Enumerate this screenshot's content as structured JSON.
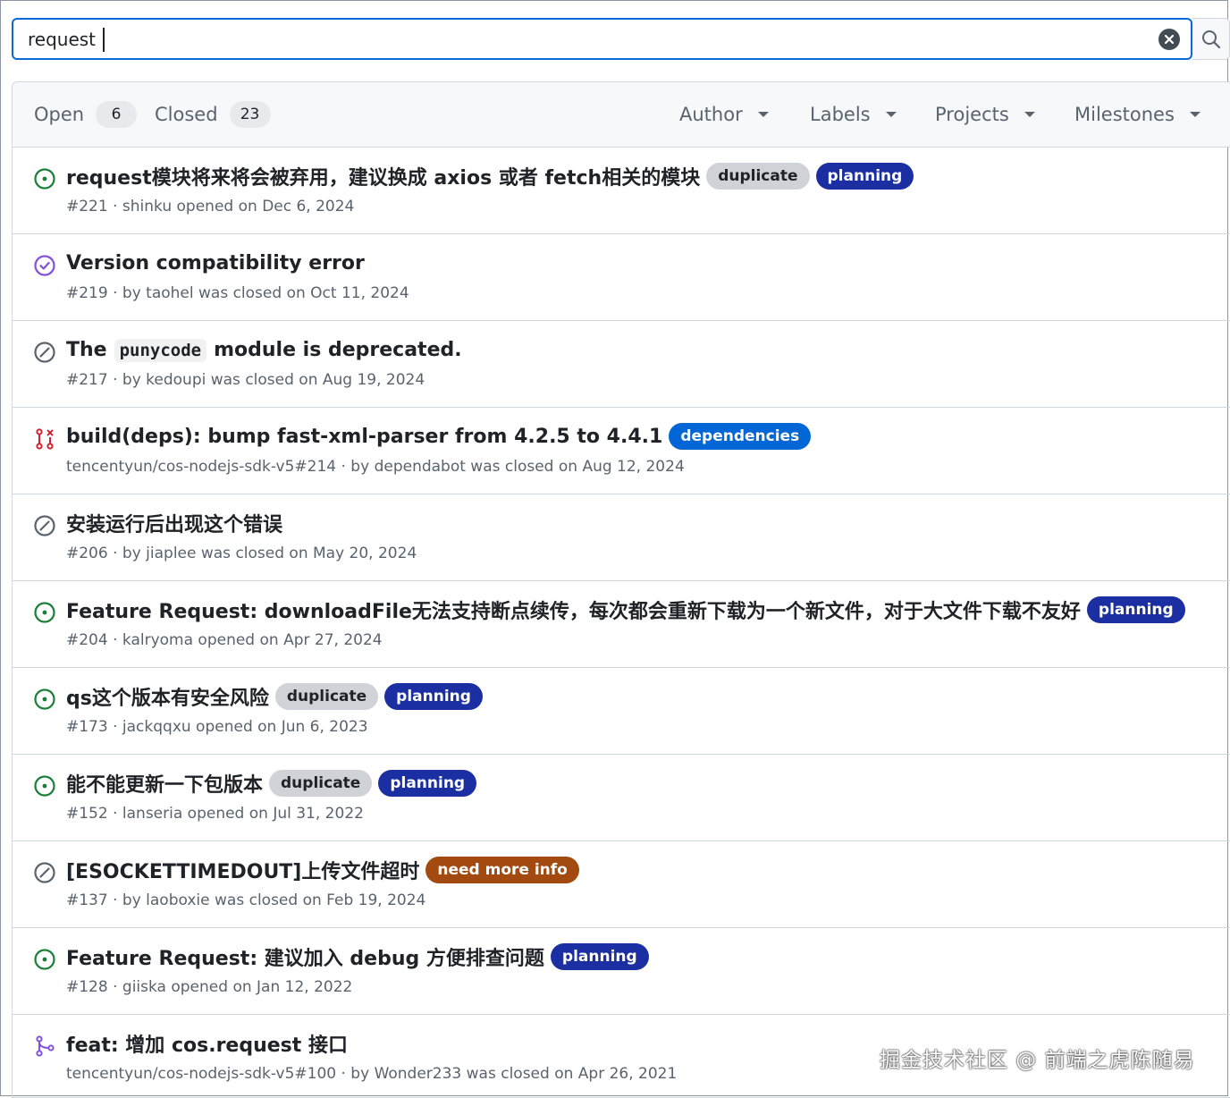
{
  "search": {
    "value": "request"
  },
  "tabs": {
    "open": {
      "label": "Open",
      "count": "6"
    },
    "closed": {
      "label": "Closed",
      "count": "23"
    }
  },
  "filters": [
    {
      "label": "Author"
    },
    {
      "label": "Labels"
    },
    {
      "label": "Projects"
    },
    {
      "label": "Milestones"
    }
  ],
  "issues": [
    {
      "state": "open",
      "title": "request模块将来将会被弃用，建议换成 axios 或者 fetch相关的模块",
      "labels": [
        "duplicate",
        "planning"
      ],
      "meta": "#221 · shinku opened on Dec 6, 2024"
    },
    {
      "state": "completed",
      "title": "Version compatibility error",
      "labels": [],
      "meta": "#219 · by taohel was closed on Oct 11, 2024"
    },
    {
      "state": "not-planned",
      "title_parts": [
        "The",
        "punycode",
        "module is deprecated."
      ],
      "labels": [],
      "meta": "#217 · by kedoupi was closed on Aug 19, 2024"
    },
    {
      "state": "pr-closed",
      "title": "build(deps): bump fast-xml-parser from 4.2.5 to 4.4.1",
      "labels": [
        "dependencies"
      ],
      "meta": "tencentyun/cos-nodejs-sdk-v5#214 · by dependabot was closed on Aug 12, 2024"
    },
    {
      "state": "not-planned",
      "title": "安装运行后出现这个错误",
      "labels": [],
      "meta": "#206 · by jiaplee was closed on May 20, 2024"
    },
    {
      "state": "open",
      "title": "Feature Request: downloadFile无法支持断点续传，每次都会重新下载为一个新文件，对于大文件下载不友好",
      "labels": [
        "planning"
      ],
      "meta": "#204 · kalryoma opened on Apr 27, 2024"
    },
    {
      "state": "open",
      "title": "qs这个版本有安全风险",
      "labels": [
        "duplicate",
        "planning"
      ],
      "meta": "#173 · jackqqxu opened on Jun 6, 2023"
    },
    {
      "state": "open",
      "title": "能不能更新一下包版本",
      "labels": [
        "duplicate",
        "planning"
      ],
      "meta": "#152 · lanseria opened on Jul 31, 2022"
    },
    {
      "state": "not-planned",
      "title": "[ESOCKETTIMEDOUT]上传文件超时",
      "labels": [
        "need more info"
      ],
      "meta": "#137 · by laoboxie was closed on Feb 19, 2024"
    },
    {
      "state": "open",
      "title": "Feature Request: 建议加入 debug 方便排查问题",
      "labels": [
        "planning"
      ],
      "meta": "#128 · giiska opened on Jan 12, 2022"
    },
    {
      "state": "pr-merged",
      "title": "feat: 增加 cos.request 接口",
      "labels": [],
      "meta": "tencentyun/cos-nodejs-sdk-v5#100 · by Wonder233 was closed on Apr 26, 2021"
    }
  ],
  "watermark": "掘金技术社区 @ 前端之虎陈随易",
  "colors": {
    "accent": "#0969da",
    "open": "#1a7f37",
    "completed": "#8250df",
    "not_planned": "#59636e",
    "pr_closed": "#cf222e",
    "pr_merged": "#8250df"
  }
}
